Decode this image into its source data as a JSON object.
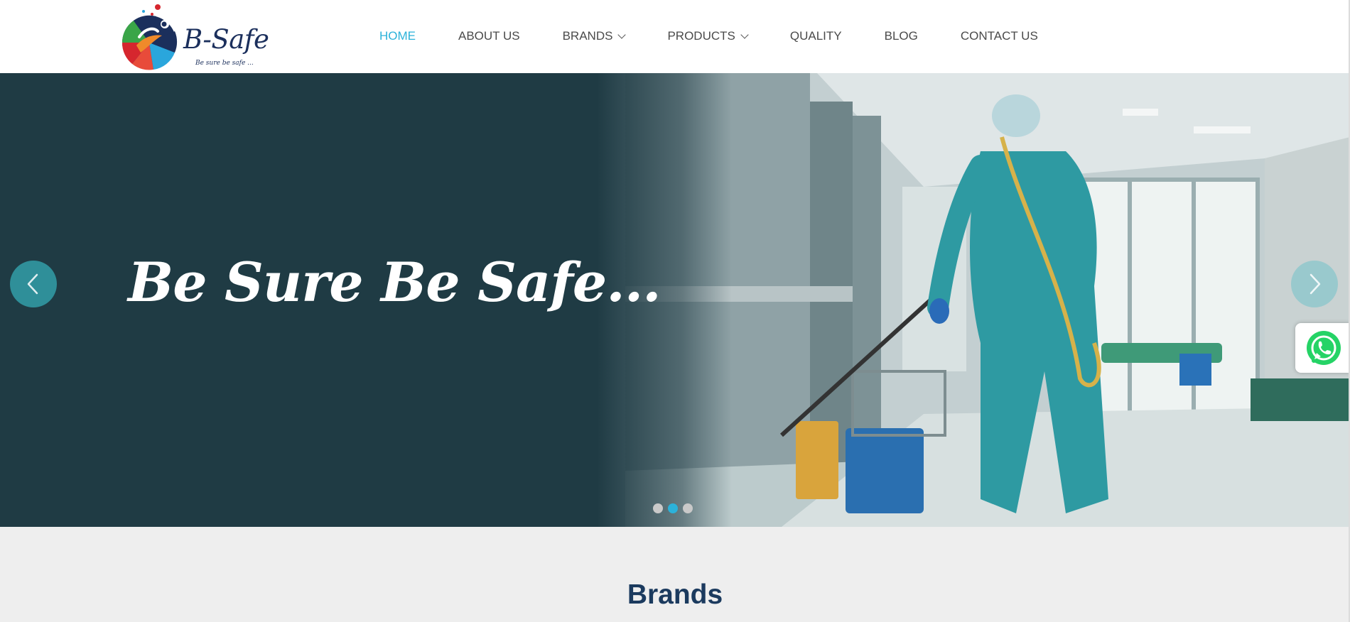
{
  "header": {
    "logo": {
      "wordmark": "B-Safe",
      "tagline": "Be sure be safe ...",
      "icon": "bsafe-logo-icon"
    },
    "nav": [
      {
        "label": "HOME",
        "active": true,
        "has_dropdown": false
      },
      {
        "label": "ABOUT US",
        "active": false,
        "has_dropdown": false
      },
      {
        "label": "BRANDS",
        "active": false,
        "has_dropdown": true
      },
      {
        "label": "PRODUCTS",
        "active": false,
        "has_dropdown": true
      },
      {
        "label": "QUALITY",
        "active": false,
        "has_dropdown": false
      },
      {
        "label": "BLOG",
        "active": false,
        "has_dropdown": false
      },
      {
        "label": "CONTACT US",
        "active": false,
        "has_dropdown": false
      }
    ]
  },
  "hero": {
    "headline": "Be Sure Be Safe...",
    "prev_icon": "chevron-left-icon",
    "next_icon": "chevron-right-icon",
    "slides_total": 3,
    "active_slide": 2
  },
  "floating": {
    "whatsapp_icon": "whatsapp-icon"
  },
  "brands_section": {
    "title": "Brands"
  },
  "colors": {
    "accent": "#2bb2da",
    "hero_overlay": "#1f3b44",
    "heading": "#1b3a5e",
    "section_bg": "#eeeeee",
    "whatsapp_green": "#25d366"
  }
}
